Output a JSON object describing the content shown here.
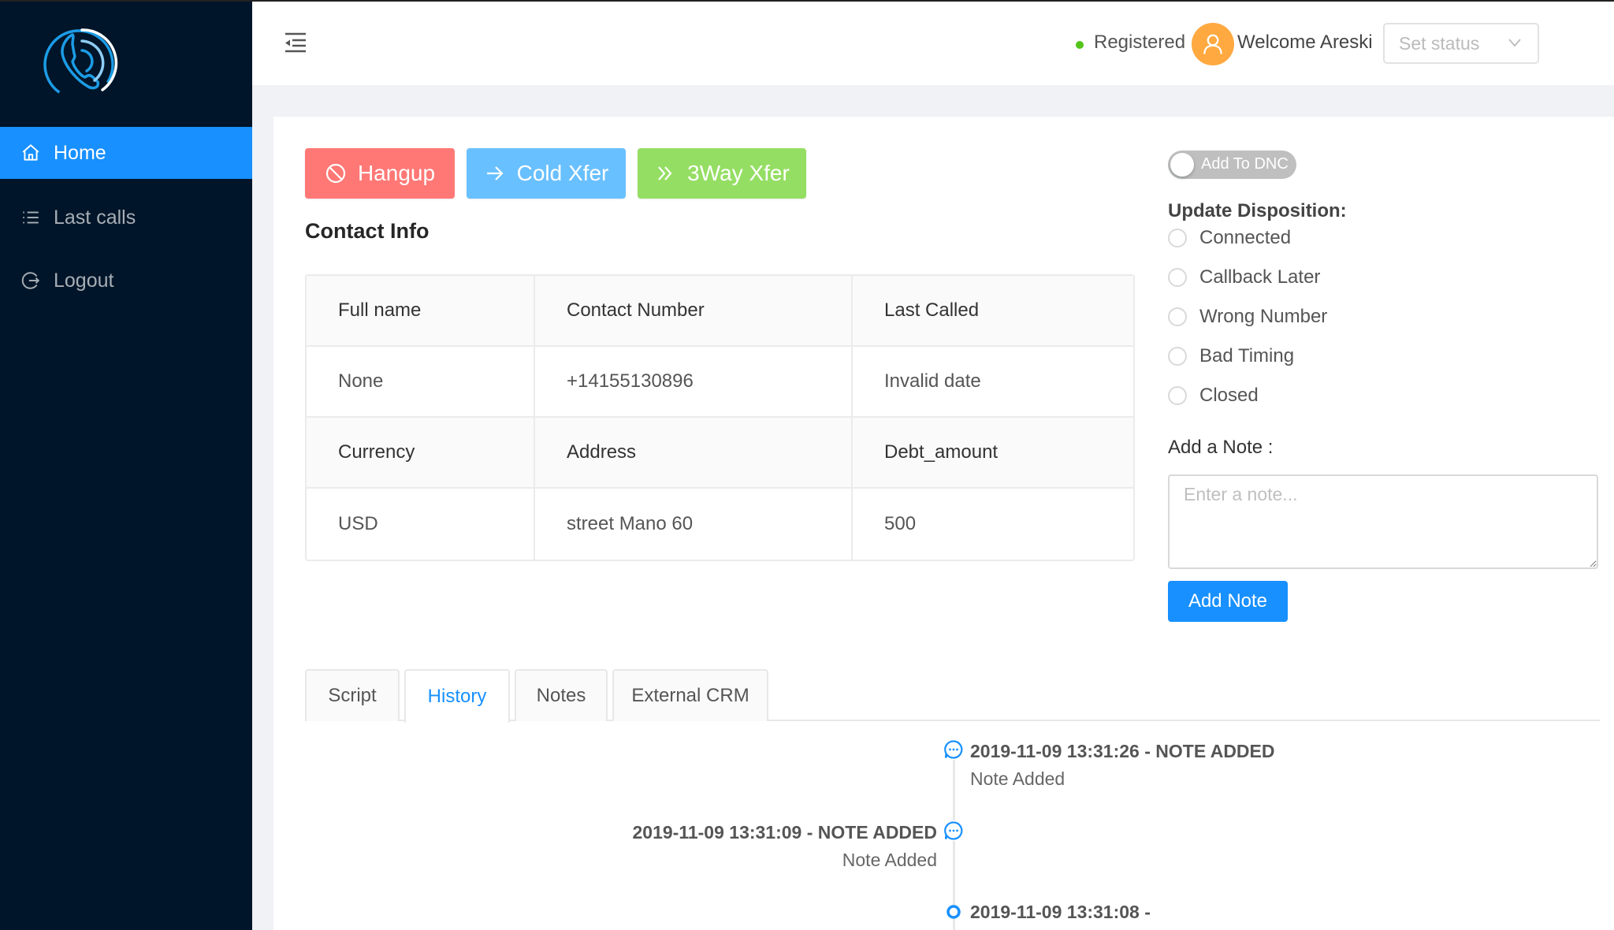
{
  "sidebar": {
    "items": [
      {
        "label": "Home",
        "icon": "home-icon",
        "active": true
      },
      {
        "label": "Last calls",
        "icon": "list-icon",
        "active": false
      },
      {
        "label": "Logout",
        "icon": "logout-icon",
        "active": false
      }
    ]
  },
  "header": {
    "registration_status": "Registered",
    "welcome_text": "Welcome Areski",
    "status_select": {
      "placeholder": "Set status"
    }
  },
  "actions": {
    "hangup": "Hangup",
    "cold_xfer": "Cold Xfer",
    "three_way_xfer": "3Way Xfer"
  },
  "contact_info": {
    "title": "Contact Info",
    "rows": [
      {
        "type": "header",
        "cells": [
          "Full name",
          "Contact Number",
          "Last Called"
        ]
      },
      {
        "type": "value",
        "cells": [
          "None",
          "+14155130896",
          "Invalid date"
        ]
      },
      {
        "type": "header",
        "cells": [
          "Currency",
          "Address",
          "Debt_amount"
        ]
      },
      {
        "type": "value",
        "cells": [
          "USD",
          "street Mano 60",
          "500"
        ]
      }
    ]
  },
  "dnc": {
    "label": "Add To DNC",
    "checked": false
  },
  "disposition": {
    "title": "Update Disposition:",
    "options": [
      "Connected",
      "Callback Later",
      "Wrong Number",
      "Bad Timing",
      "Closed"
    ],
    "selected": null
  },
  "note": {
    "label": "Add a Note :",
    "placeholder": "Enter a note...",
    "value": "",
    "button": "Add Note"
  },
  "tabs": [
    {
      "label": "Script",
      "active": false
    },
    {
      "label": "History",
      "active": true
    },
    {
      "label": "Notes",
      "active": false
    },
    {
      "label": "External CRM",
      "active": false
    }
  ],
  "history": [
    {
      "title": "2019-11-09 13:31:26 - NOTE ADDED",
      "body": "Note Added",
      "side": "right",
      "icon": "message-icon"
    },
    {
      "title": "2019-11-09 13:31:09 - NOTE ADDED",
      "body": "Note Added",
      "side": "left",
      "icon": "message-icon"
    },
    {
      "title": "2019-11-09 13:31:08 -",
      "body": "",
      "side": "right",
      "icon": "dot-icon"
    }
  ],
  "colors": {
    "sidebar_bg": "#001529",
    "primary": "#1890ff",
    "hangup": "#ff7875",
    "cold_xfer": "#69c0ff",
    "three_way": "#95de64",
    "avatar": "#ffa940",
    "registered": "#52c41a"
  }
}
